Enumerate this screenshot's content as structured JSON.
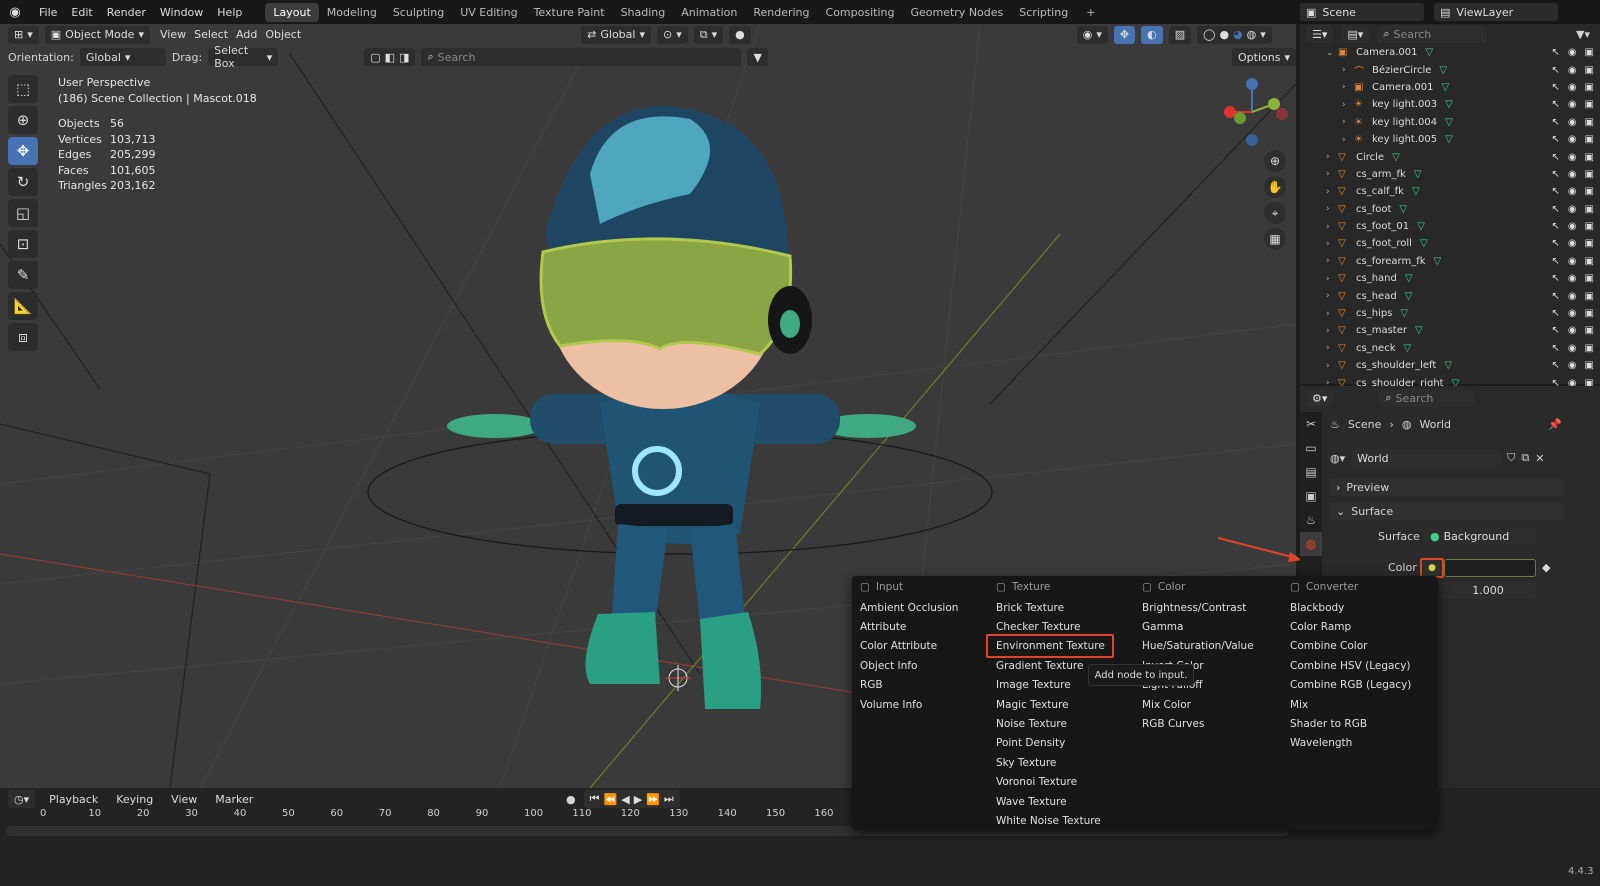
{
  "menus": [
    "File",
    "Edit",
    "Render",
    "Window",
    "Help"
  ],
  "workspaces": [
    "Layout",
    "Modeling",
    "Sculpting",
    "UV Editing",
    "Texture Paint",
    "Shading",
    "Animation",
    "Rendering",
    "Compositing",
    "Geometry Nodes",
    "Scripting"
  ],
  "active_workspace": "Layout",
  "scene_label": "Scene",
  "viewlayer_label": "ViewLayer",
  "viewport": {
    "mode": "Object Mode",
    "menu": [
      "View",
      "Select",
      "Add",
      "Object"
    ],
    "transform_space": "Global",
    "orientation_label": "Orientation:",
    "orientation": "Global",
    "drag_label": "Drag:",
    "drag": "Select Box",
    "search_placeholder": "Search",
    "options": "Options",
    "perspective": "User Perspective",
    "collection": "(186) Scene Collection | Mascot.018",
    "stats": [
      {
        "k": "Objects",
        "v": "56"
      },
      {
        "k": "Vertices",
        "v": "103,713"
      },
      {
        "k": "Edges",
        "v": "205,299"
      },
      {
        "k": "Faces",
        "v": "101,605"
      },
      {
        "k": "Triangles",
        "v": "203,162"
      }
    ]
  },
  "outliner": {
    "search_placeholder": "Search",
    "rows": [
      {
        "name": "Camera.001",
        "indent": 1,
        "icon": "cam"
      },
      {
        "name": "BézierCircle",
        "indent": 2,
        "icon": "curve"
      },
      {
        "name": "Camera.001",
        "indent": 2,
        "icon": "cam"
      },
      {
        "name": "key light.003",
        "indent": 2,
        "icon": "light"
      },
      {
        "name": "key light.004",
        "indent": 2,
        "icon": "light"
      },
      {
        "name": "key light.005",
        "indent": 2,
        "icon": "light"
      },
      {
        "name": "Circle",
        "indent": 1,
        "icon": "mesh"
      },
      {
        "name": "cs_arm_fk",
        "indent": 1,
        "icon": "mesh"
      },
      {
        "name": "cs_calf_fk",
        "indent": 1,
        "icon": "mesh"
      },
      {
        "name": "cs_foot",
        "indent": 1,
        "icon": "mesh"
      },
      {
        "name": "cs_foot_01",
        "indent": 1,
        "icon": "mesh"
      },
      {
        "name": "cs_foot_roll",
        "indent": 1,
        "icon": "mesh"
      },
      {
        "name": "cs_forearm_fk",
        "indent": 1,
        "icon": "mesh"
      },
      {
        "name": "cs_hand",
        "indent": 1,
        "icon": "mesh"
      },
      {
        "name": "cs_head",
        "indent": 1,
        "icon": "mesh"
      },
      {
        "name": "cs_hips",
        "indent": 1,
        "icon": "mesh"
      },
      {
        "name": "cs_master",
        "indent": 1,
        "icon": "mesh"
      },
      {
        "name": "cs_neck",
        "indent": 1,
        "icon": "mesh"
      },
      {
        "name": "cs_shoulder_left",
        "indent": 1,
        "icon": "mesh"
      },
      {
        "name": "cs_shoulder_right",
        "indent": 1,
        "icon": "mesh"
      }
    ]
  },
  "properties": {
    "search_placeholder": "Search",
    "breadcrumb_scene": "Scene",
    "breadcrumb_world": "World",
    "world_name": "World",
    "preview": "Preview",
    "surface": "Surface",
    "surface_label": "Surface",
    "surface_value": "Background",
    "color_label": "Color",
    "strength_value": "1.000"
  },
  "timeline": {
    "menu": [
      "Playback",
      "Keying",
      "View",
      "Marker"
    ],
    "ticks": [
      "0",
      "10",
      "20",
      "30",
      "40",
      "50",
      "60",
      "70",
      "80",
      "90",
      "100",
      "110",
      "120",
      "130",
      "140",
      "150",
      "160"
    ],
    "version": "4.4.3"
  },
  "popup": {
    "columns": [
      {
        "title": "Input",
        "items": [
          "Ambient Occlusion",
          "Attribute",
          "Color Attribute",
          "Object Info",
          "RGB",
          "Volume Info"
        ]
      },
      {
        "title": "Texture",
        "items": [
          "Brick Texture",
          "Checker Texture",
          "Environment Texture",
          "Gradient Texture",
          "Image Texture",
          "Magic Texture",
          "Noise Texture",
          "Point Density",
          "Sky Texture",
          "Voronoi Texture",
          "Wave Texture",
          "White Noise Texture"
        ]
      },
      {
        "title": "Color",
        "items": [
          "Brightness/Contrast",
          "Gamma",
          "Hue/Saturation/Value",
          "Invert Color",
          "Light Falloff",
          "Mix Color",
          "RGB Curves"
        ]
      },
      {
        "title": "Converter",
        "items": [
          "Blackbody",
          "Color Ramp",
          "Combine Color",
          "Combine HSV (Legacy)",
          "Combine RGB (Legacy)",
          "Mix",
          "Shader to RGB",
          "Wavelength"
        ]
      }
    ],
    "tooltip": "Add node to input."
  },
  "colors": {
    "accent": "#4772b3",
    "highlight": "#e0452a",
    "mesh_icon": "#e0863a",
    "vertex_group": "#3ccf8e"
  }
}
